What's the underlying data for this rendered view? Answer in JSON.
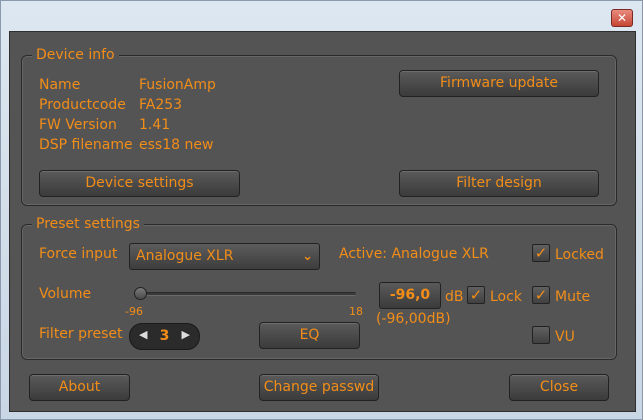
{
  "window": {
    "close_glyph": "✕"
  },
  "device_info": {
    "legend": "Device info",
    "rows": [
      {
        "label": "Name",
        "value": "FusionAmp"
      },
      {
        "label": "Productcode",
        "value": "FA253"
      },
      {
        "label": "FW Version",
        "value": "1.41"
      },
      {
        "label": "DSP filename",
        "value": "ess18 new"
      }
    ],
    "firmware_update_label": "Firmware update",
    "device_settings_label": "Device settings",
    "filter_design_label": "Filter design"
  },
  "preset_settings": {
    "legend": "Preset settings",
    "force_input_label": "Force input",
    "force_input_value": "Analogue XLR",
    "active_text": "Active: Analogue XLR",
    "locked_label": "Locked",
    "locked_checked": true,
    "volume_label": "Volume",
    "volume_min": "-96",
    "volume_max": "18",
    "volume_level": -96,
    "volume_value": "-96,0",
    "volume_unit": "dB",
    "volume_subtext": "(-96,00dB)",
    "lock_label": "Lock",
    "lock_checked": true,
    "mute_label": "Mute",
    "mute_checked": true,
    "filter_preset_label": "Filter preset",
    "filter_preset_value": "3",
    "eq_label": "EQ",
    "vu_label": "VU",
    "vu_checked": false
  },
  "footer": {
    "about_label": "About",
    "change_passwd_label": "Change passwd",
    "close_label": "Close"
  },
  "colors": {
    "accent": "#f28d18",
    "panel": "#545454",
    "button": "#444444"
  }
}
